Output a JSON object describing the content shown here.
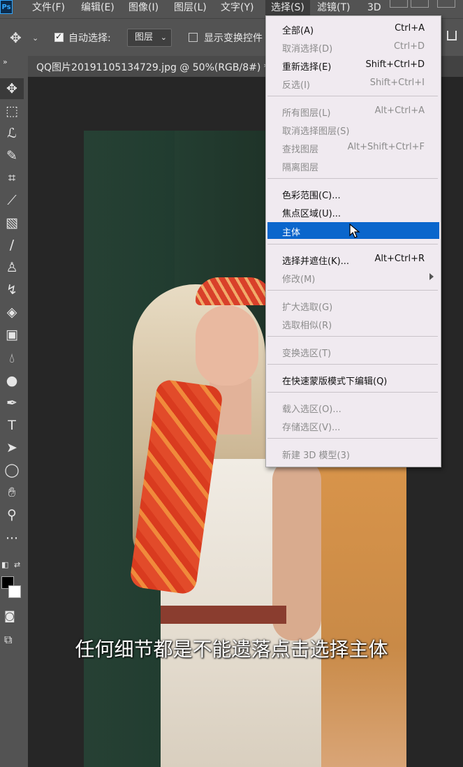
{
  "app": {
    "logo": "Ps"
  },
  "menubar": {
    "items": [
      {
        "label": "文件(F)"
      },
      {
        "label": "编辑(E)"
      },
      {
        "label": "图像(I)"
      },
      {
        "label": "图层(L)"
      },
      {
        "label": "文字(Y)"
      },
      {
        "label": "选择(S)"
      },
      {
        "label": "滤镜(T)"
      },
      {
        "label": "3D"
      }
    ],
    "active": "选择(S)"
  },
  "options": {
    "auto_select_label": "自动选择:",
    "auto_select_checked": true,
    "layer_dropdown_value": "图层",
    "show_transform_label": "显示变换控件",
    "show_transform_checked": false
  },
  "document_tab": {
    "title": "QQ图片20191105134729.jpg @ 50%(RGB/8#) *"
  },
  "tools": [
    "move-tool",
    "marquee-tool",
    "lasso-tool",
    "quick-select-tool",
    "crop-tool",
    "eyedropper-tool",
    "healing-tool",
    "brush-tool",
    "stamp-tool",
    "history-brush-tool",
    "eraser-tool",
    "gradient-tool",
    "blur-tool",
    "dodge-tool",
    "pen-tool",
    "type-tool",
    "path-select-tool",
    "ellipse-tool",
    "hand-tool",
    "zoom-tool",
    "more-tools"
  ],
  "colors": {
    "foreground": "#000000",
    "background": "#ffffff",
    "highlight": "#0a66cc"
  },
  "select_menu": {
    "items": [
      {
        "label": "全部(A)",
        "shortcut": "Ctrl+A",
        "enabled": true
      },
      {
        "label": "取消选择(D)",
        "shortcut": "Ctrl+D",
        "enabled": false
      },
      {
        "label": "重新选择(E)",
        "shortcut": "Shift+Ctrl+D",
        "enabled": true
      },
      {
        "label": "反选(I)",
        "shortcut": "Shift+Ctrl+I",
        "enabled": false
      },
      {
        "label": "所有图层(L)",
        "shortcut": "Alt+Ctrl+A",
        "enabled": false
      },
      {
        "label": "取消选择图层(S)",
        "shortcut": "",
        "enabled": false
      },
      {
        "label": "查找图层",
        "shortcut": "Alt+Shift+Ctrl+F",
        "enabled": false
      },
      {
        "label": "隔离图层",
        "shortcut": "",
        "enabled": false
      },
      {
        "label": "色彩范围(C)...",
        "shortcut": "",
        "enabled": true
      },
      {
        "label": "焦点区域(U)...",
        "shortcut": "",
        "enabled": true
      },
      {
        "label": "主体",
        "shortcut": "",
        "enabled": true,
        "highlighted": true
      },
      {
        "label": "选择并遮住(K)...",
        "shortcut": "Alt+Ctrl+R",
        "enabled": true
      },
      {
        "label": "修改(M)",
        "shortcut": "",
        "enabled": false,
        "submenu": true
      },
      {
        "label": "扩大选取(G)",
        "shortcut": "",
        "enabled": false
      },
      {
        "label": "选取相似(R)",
        "shortcut": "",
        "enabled": false
      },
      {
        "label": "变换选区(T)",
        "shortcut": "",
        "enabled": false
      },
      {
        "label": "在快速蒙版模式下编辑(Q)",
        "shortcut": "",
        "enabled": true
      },
      {
        "label": "载入选区(O)...",
        "shortcut": "",
        "enabled": false
      },
      {
        "label": "存储选区(V)...",
        "shortcut": "",
        "enabled": false
      },
      {
        "label": "新建 3D 模型(3)",
        "shortcut": "",
        "enabled": false
      }
    ]
  },
  "subtitle": "任何细节都是不能遗落点击选择主体"
}
